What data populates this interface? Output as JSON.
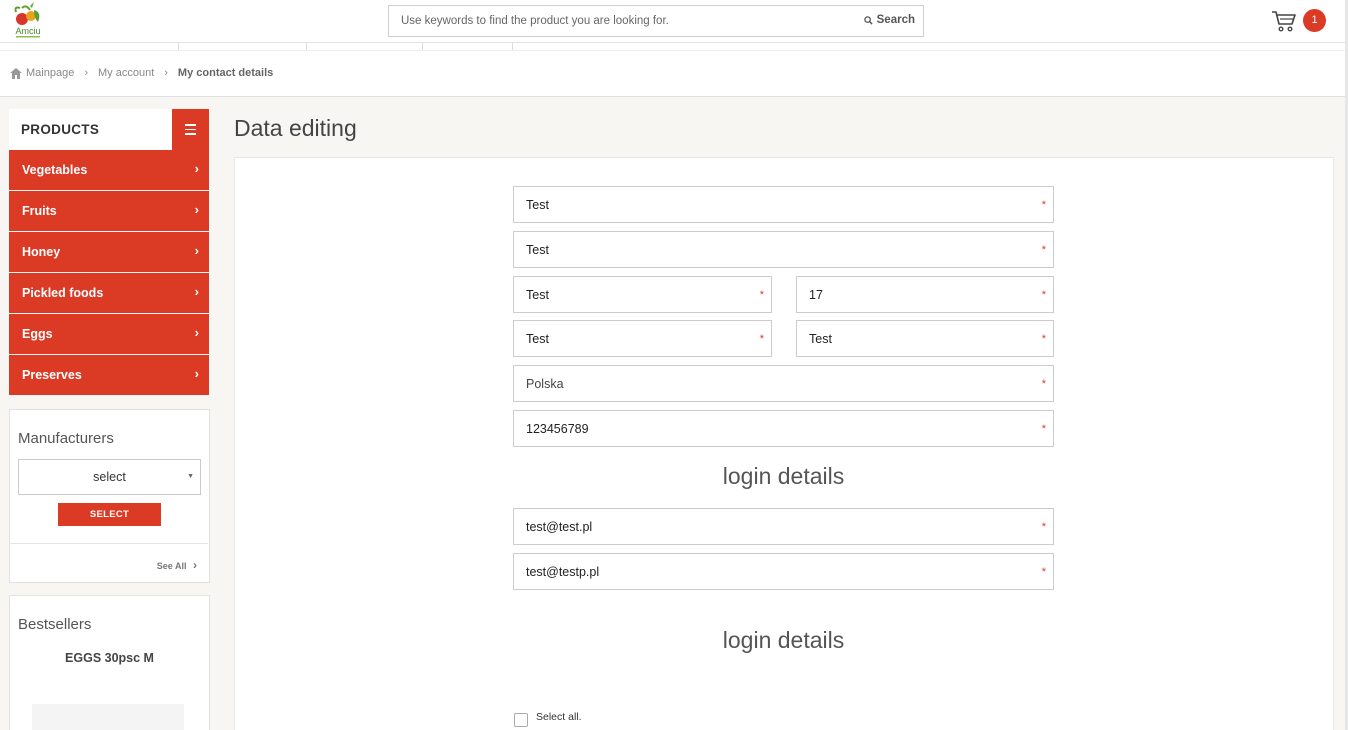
{
  "header": {
    "logo_text": "Amciu",
    "search_placeholder": "Use keywords to find the product you are looking for.",
    "search_button": "Search",
    "cart_count": "1"
  },
  "breadcrumb": {
    "home": "Mainpage",
    "account": "My account",
    "current": "My contact details"
  },
  "sidebar": {
    "products_title": "PRODUCTS",
    "categories": [
      "Vegetables",
      "Fruits",
      "Honey",
      "Pickled foods",
      "Eggs",
      "Preserves"
    ],
    "manufacturers": {
      "title": "Manufacturers",
      "select_value": "select",
      "select_button": "SELECT",
      "see_all": "See All"
    },
    "bestsellers": {
      "title": "Bestsellers",
      "product": "EGGS 30psc M"
    }
  },
  "main": {
    "page_title": "Data editing",
    "fields": {
      "first_name": "Test",
      "last_name": "Test",
      "street": "Test",
      "house_number": "17",
      "postal_code": "Test",
      "city": "Test",
      "country": "Polska",
      "phone": "123456789",
      "email": "test@test.pl",
      "email_confirm": "test@testp.pl"
    },
    "section_login": "login details",
    "section_login_2": "login details",
    "required_mark": "*",
    "select_all": "Select all."
  },
  "colors": {
    "accent": "#db3a25",
    "background": "#f8f6f3"
  }
}
